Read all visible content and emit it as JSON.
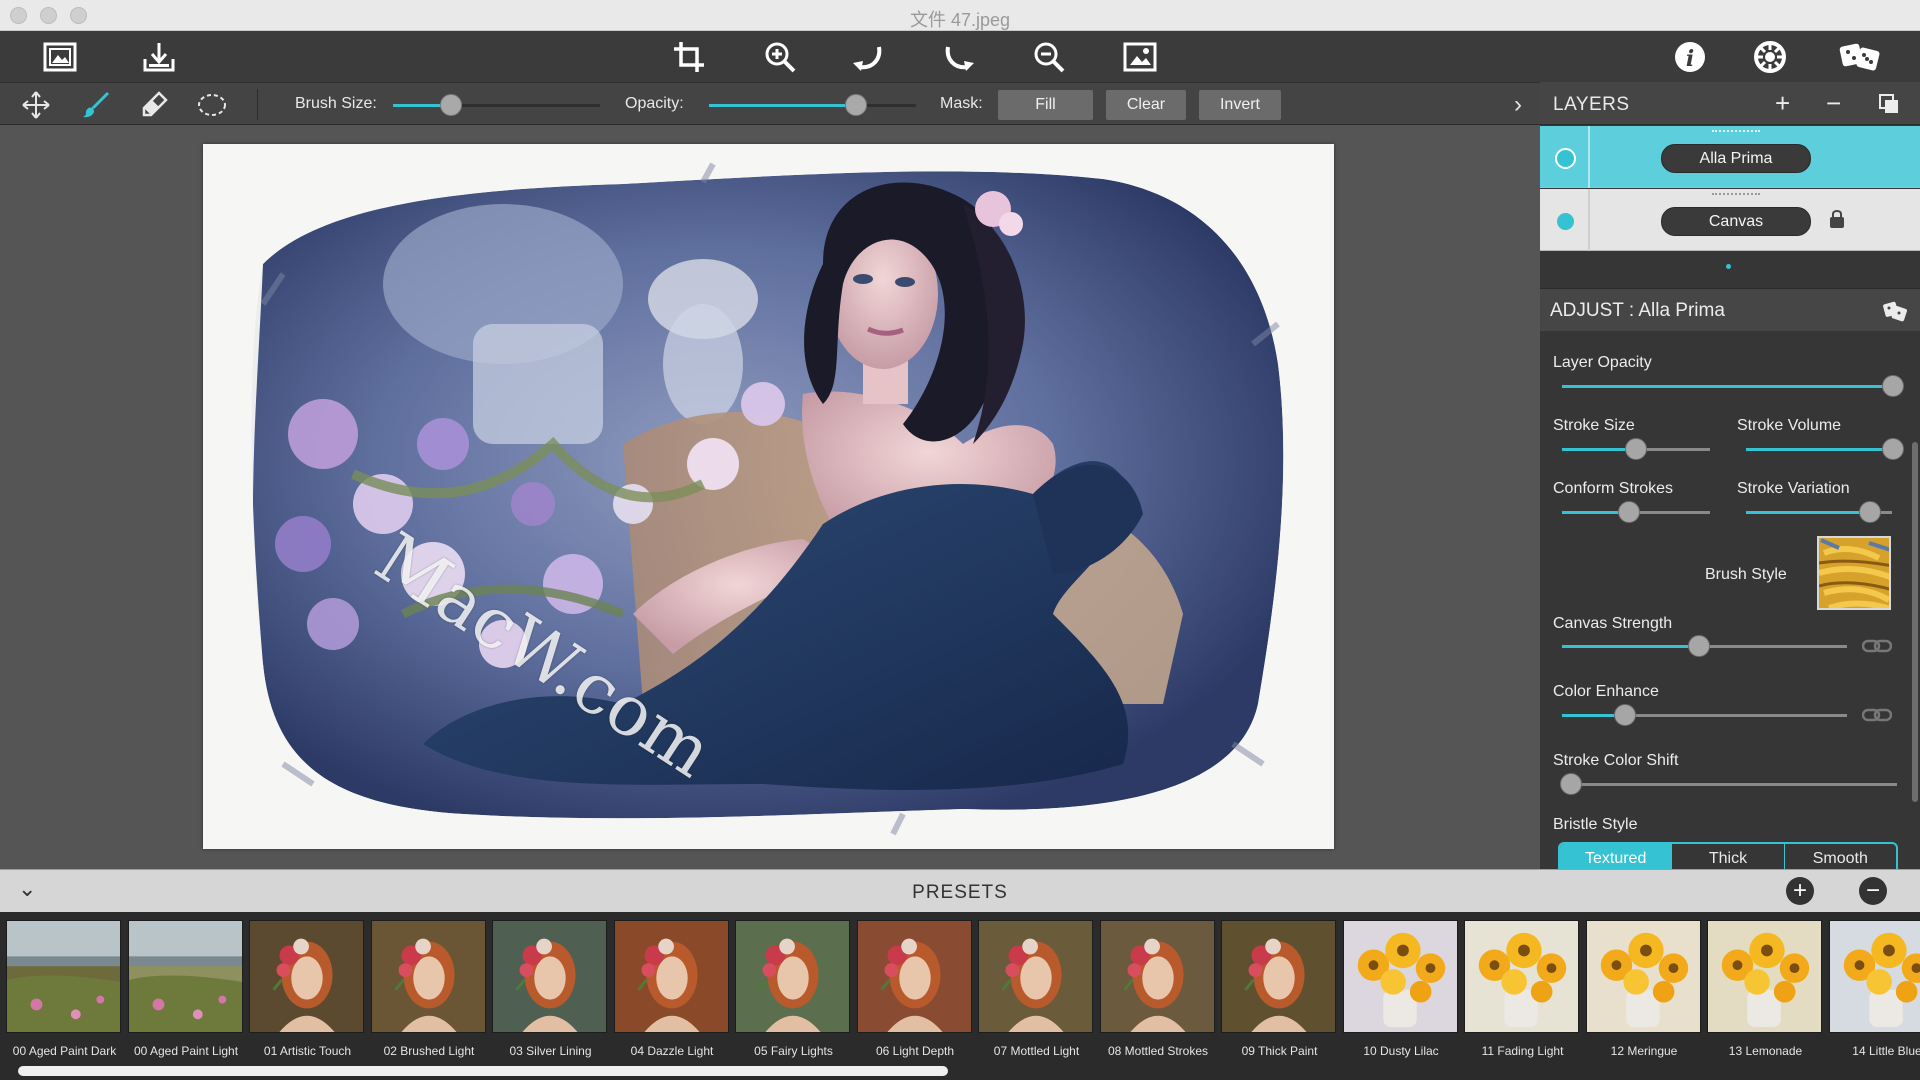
{
  "window": {
    "title": "文件 47.jpeg"
  },
  "toolbar": {
    "left": [
      "open-image-icon",
      "save-export-icon"
    ],
    "center": [
      "crop-icon",
      "zoom-in-icon",
      "undo-icon",
      "redo-icon",
      "zoom-out-icon",
      "fit-image-icon"
    ],
    "right": [
      "info-icon",
      "settings-icon",
      "randomize-icon"
    ]
  },
  "tools": {
    "items": [
      "move-tool-icon",
      "brush-tool-icon",
      "eraser-tool-icon",
      "lasso-tool-icon"
    ],
    "brush_size_label": "Brush Size:",
    "brush_size_value": 0.28,
    "opacity_label": "Opacity:",
    "opacity_value": 0.72,
    "mask_label": "Mask:",
    "mask_buttons": [
      "Fill",
      "Clear",
      "Invert"
    ]
  },
  "layers": {
    "title": "LAYERS",
    "items": [
      {
        "name": "Alla Prima",
        "selected": true,
        "locked": false
      },
      {
        "name": "Canvas",
        "selected": false,
        "locked": true
      }
    ]
  },
  "adjust": {
    "title": "ADJUST : Alla Prima",
    "controls": {
      "layer_opacity": {
        "label": "Layer Opacity",
        "value": 1.0
      },
      "stroke_size": {
        "label": "Stroke Size",
        "value": 0.5
      },
      "stroke_volume": {
        "label": "Stroke Volume",
        "value": 1.0
      },
      "conform_strokes": {
        "label": "Conform Strokes",
        "value": 0.45
      },
      "stroke_variation": {
        "label": "Stroke Variation",
        "value": 0.85
      },
      "brush_style": {
        "label": "Brush Style"
      },
      "canvas_strength": {
        "label": "Canvas Strength",
        "value": 0.48
      },
      "color_enhance": {
        "label": "Color Enhance",
        "value": 0.22
      },
      "stroke_color_shift": {
        "label": "Stroke Color Shift",
        "value": 0.0
      },
      "bristle_style": {
        "label": "Bristle Style",
        "options": [
          "Textured",
          "Thick",
          "Smooth"
        ],
        "selected": "Textured"
      }
    }
  },
  "presets": {
    "title": "PRESETS",
    "items": [
      {
        "label": "00 Aged Paint Dark",
        "kind": "landscape"
      },
      {
        "label": "00 Aged Paint Light",
        "kind": "landscape"
      },
      {
        "label": "01 Artistic Touch",
        "kind": "portrait"
      },
      {
        "label": "02 Brushed Light",
        "kind": "portrait"
      },
      {
        "label": "03 Silver Lining",
        "kind": "portrait"
      },
      {
        "label": "04 Dazzle Light",
        "kind": "portrait"
      },
      {
        "label": "05 Fairy Lights",
        "kind": "portrait"
      },
      {
        "label": "06 Light Depth",
        "kind": "portrait"
      },
      {
        "label": "07 Mottled Light",
        "kind": "portrait"
      },
      {
        "label": "08 Mottled Strokes",
        "kind": "portrait"
      },
      {
        "label": "09 Thick Paint",
        "kind": "portrait"
      },
      {
        "label": "10 Dusty Lilac",
        "kind": "flowers"
      },
      {
        "label": "11 Fading Light",
        "kind": "flowers"
      },
      {
        "label": "12 Meringue",
        "kind": "flowers"
      },
      {
        "label": "13 Lemonade",
        "kind": "flowers"
      },
      {
        "label": "14 Little Blue",
        "kind": "flowers"
      }
    ]
  },
  "watermark": "MacW.com",
  "colors": {
    "accent": "#35c3d3",
    "toolbar": "#3b3b3b",
    "panel": "#363636"
  }
}
